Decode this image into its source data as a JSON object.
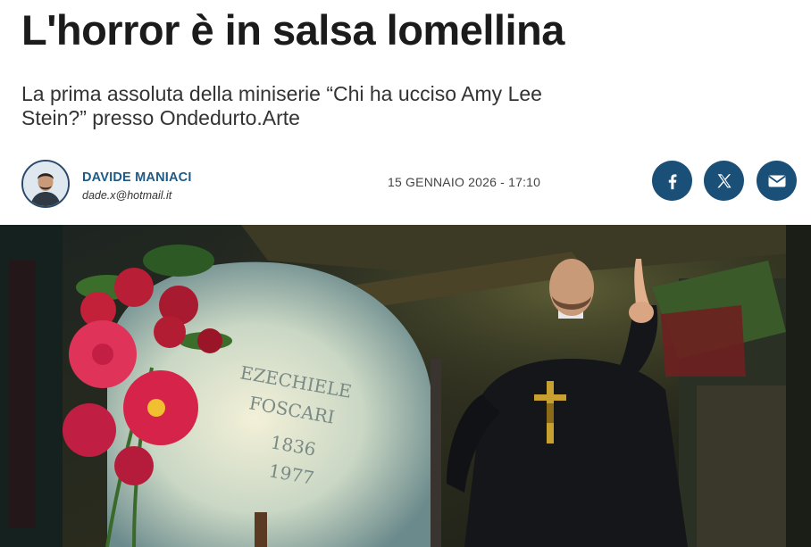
{
  "article": {
    "headline": "L'horror è in salsa lomellina",
    "subtitle": "La prima assoluta della miniserie “Chi ha ucciso Amy Lee Stein?” presso Ondedurto.Arte"
  },
  "author": {
    "name": "DAVIDE MANIACI",
    "email": "dade.x@hotmail.it"
  },
  "meta": {
    "datetime": "15 GENNAIO 2026 - 17:10"
  },
  "share": {
    "buttons": [
      "facebook-icon",
      "x-icon",
      "mail-icon"
    ],
    "color": "#1a4f78"
  },
  "hero": {
    "tombstone_text": [
      "EZECHIELE",
      "FOSCARI",
      "1836",
      "1977"
    ]
  }
}
